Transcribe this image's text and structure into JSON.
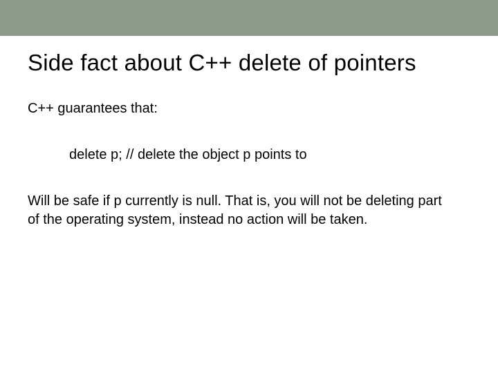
{
  "slide": {
    "title": "Side fact about C++ delete of pointers",
    "intro": "C++ guarantees that:",
    "code": "delete p;  // delete the object p points to",
    "explain": "Will be safe if p currently is null.  That is, you will not be deleting part of the operating system, instead no action will be taken."
  }
}
